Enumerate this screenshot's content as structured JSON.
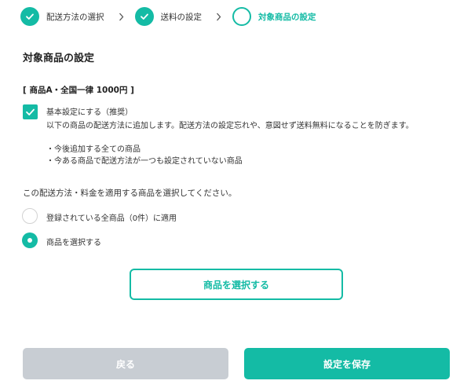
{
  "stepper": {
    "steps": [
      {
        "label": "配送方法の選択",
        "state": "done"
      },
      {
        "label": "送料の設定",
        "state": "done"
      },
      {
        "label": "対象商品の設定",
        "state": "current"
      }
    ]
  },
  "main": {
    "title": "対象商品の設定",
    "product_heading": "[ 商品A・全国一律 1000円 ]",
    "default_setting": {
      "label": "基本設定にする（推奨）",
      "checked": true,
      "description": "以下の商品の配送方法に追加します。配送方法の設定忘れや、意図せず送料無料になることを防ぎます。",
      "bullets": [
        "・今後追加する全ての商品",
        "・今ある商品で配送方法が一つも設定されていない商品"
      ]
    },
    "instruction": "この配送方法・料金を適用する商品を選択してください。",
    "options": [
      {
        "label": "登録されている全商品（0件）に適用",
        "selected": false
      },
      {
        "label": "商品を選択する",
        "selected": true
      }
    ],
    "select_button": "商品を選択する"
  },
  "footer": {
    "back_label": "戻る",
    "save_label": "設定を保存"
  },
  "colors": {
    "accent": "#14bba5",
    "disabled": "#c8cdd3"
  }
}
